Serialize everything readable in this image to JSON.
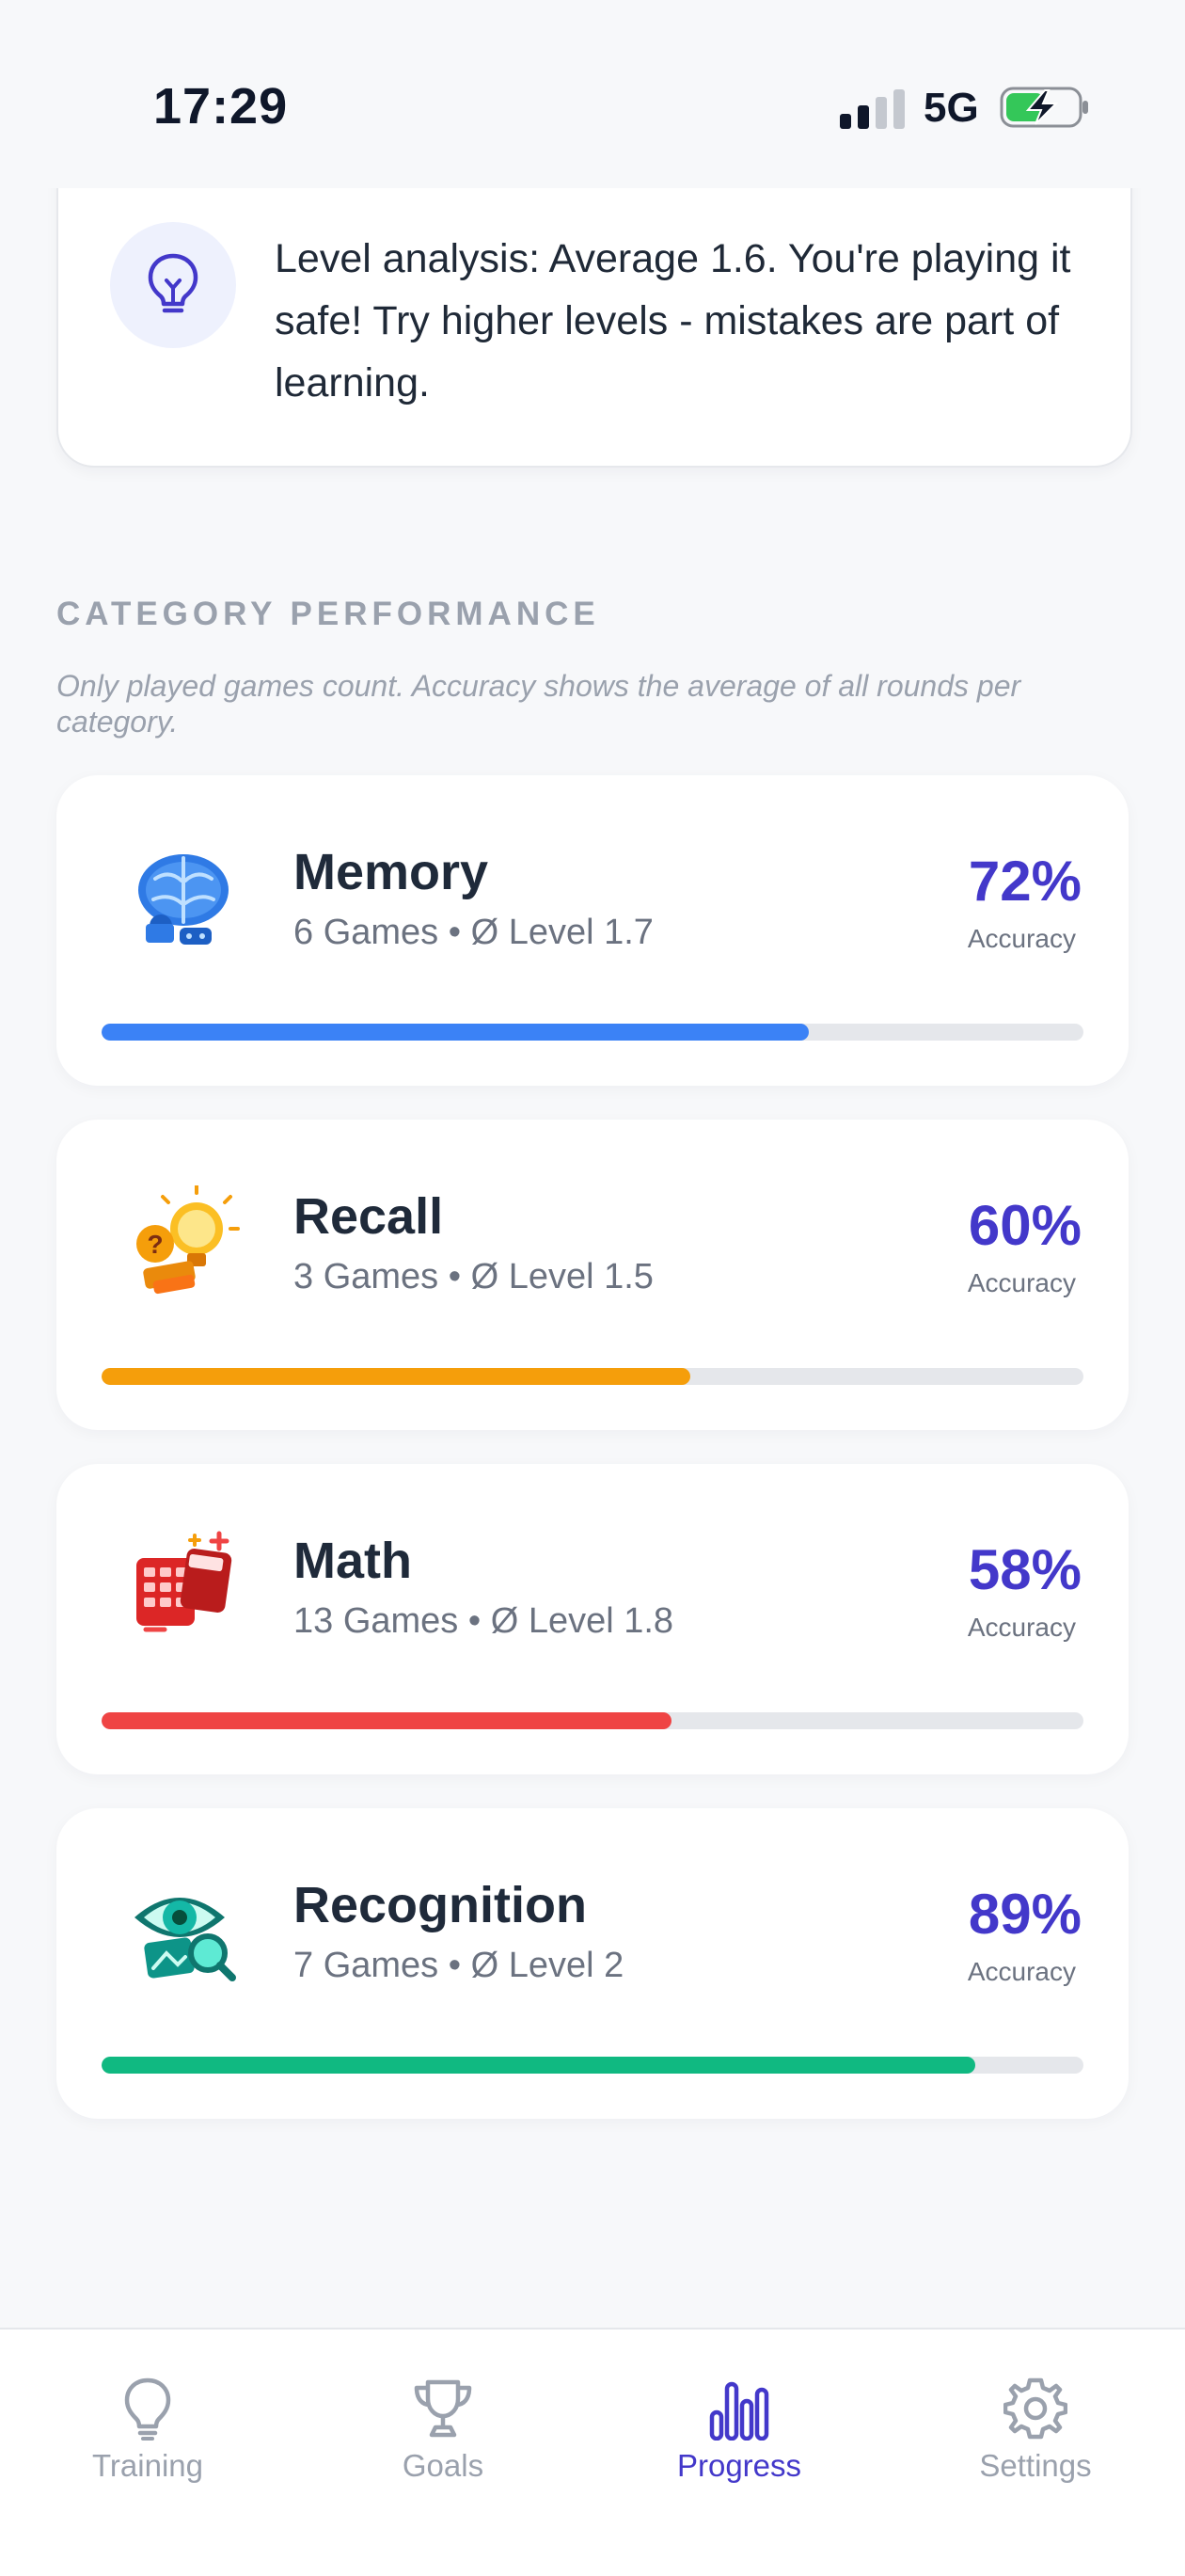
{
  "status": {
    "time": "17:29",
    "network": "5G"
  },
  "tip": {
    "text": "Level analysis: Average 1.6. You're playing it safe! Try higher levels - mistakes are part of learning."
  },
  "section": {
    "title": "CATEGORY PERFORMANCE",
    "note": "Only played games count. Accuracy shows the average of all rounds per category."
  },
  "categories": [
    {
      "name": "Memory",
      "meta": "6 Games • Ø Level 1.7",
      "accuracy_label": "72%",
      "accuracy": 0.72,
      "accuracy_caption": "Accuracy",
      "color": "#3b82f6",
      "icon": "brain-icon"
    },
    {
      "name": "Recall",
      "meta": "3 Games • Ø Level 1.5",
      "accuracy_label": "60%",
      "accuracy": 0.6,
      "accuracy_caption": "Accuracy",
      "color": "#f59e0b",
      "icon": "lightbulb-question-icon"
    },
    {
      "name": "Math",
      "meta": "13 Games • Ø Level 1.8",
      "accuracy_label": "58%",
      "accuracy": 0.58,
      "accuracy_caption": "Accuracy",
      "color": "#ef4444",
      "icon": "calculator-icon"
    },
    {
      "name": "Recognition",
      "meta": "7 Games • Ø Level 2",
      "accuracy_label": "89%",
      "accuracy": 0.89,
      "accuracy_caption": "Accuracy",
      "color": "#10b981",
      "icon": "eye-magnifier-icon"
    }
  ],
  "nav": {
    "items": [
      {
        "label": "Training",
        "icon": "lightbulb-icon"
      },
      {
        "label": "Goals",
        "icon": "trophy-icon"
      },
      {
        "label": "Progress",
        "icon": "bar-chart-icon",
        "active": true
      },
      {
        "label": "Settings",
        "icon": "gear-icon"
      }
    ]
  },
  "colors": {
    "accent": "#4338ca",
    "muted": "#9aa1ad",
    "background": "#f7f8fa"
  }
}
